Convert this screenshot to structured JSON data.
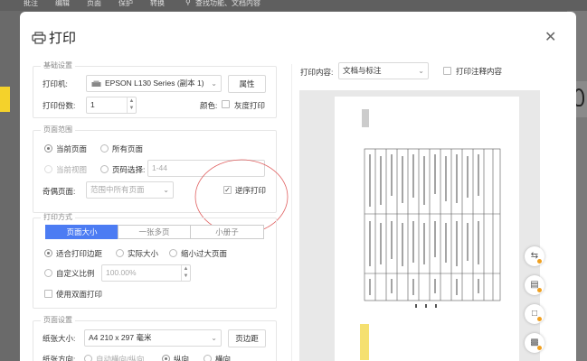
{
  "background_app": {
    "menu": [
      "批注",
      "编辑",
      "页面",
      "保护",
      "转换"
    ],
    "search_placeholder": "查找功能、文档内容"
  },
  "dialog": {
    "title": "打印",
    "basic": {
      "group_title": "基础设置",
      "printer_label": "打印机:",
      "printer_value": "EPSON L130 Series (副本 1)",
      "properties_button": "属性",
      "copies_label": "打印份数:",
      "copies_value": "1",
      "color_label": "颜色:",
      "grayscale_label": "灰度打印"
    },
    "range": {
      "group_title": "页面范围",
      "current_page": "当前页面",
      "all_pages": "所有页面",
      "current_view": "当前视图",
      "page_select": "页码选择:",
      "page_select_value": "1-44",
      "odd_even_label": "奇偶页面:",
      "odd_even_value": "范围中所有页面",
      "reverse_label": "逆序打印"
    },
    "mode": {
      "group_title": "打印方式",
      "tabs": [
        "页面大小",
        "一张多页",
        "小册子"
      ],
      "fit_margin": "适合打印边距",
      "actual_size": "实际大小",
      "shrink": "缩小过大页面",
      "custom_scale": "自定义比例",
      "scale_value": "100.00%",
      "duplex": "使用双面打印"
    },
    "page_setup": {
      "group_title": "页面设置",
      "paper_label": "纸张大小:",
      "paper_value": "A4 210 x 297 毫米",
      "margin_button": "页边距",
      "orientation_label": "纸张方向:",
      "auto_orient": "自动横向/纵向",
      "portrait": "纵向",
      "landscape": "横向"
    },
    "preview": {
      "content_label": "打印内容:",
      "content_value": "文档与标注",
      "print_comments": "打印注释内容"
    }
  },
  "colors": {
    "accent": "#4c7cf3",
    "annotation_circle": "#e06060"
  }
}
